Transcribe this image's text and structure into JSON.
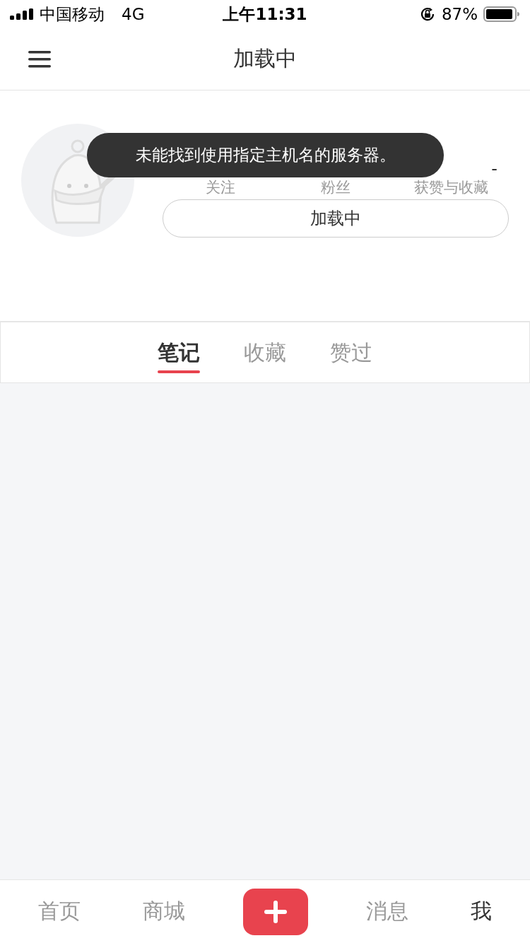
{
  "status_bar": {
    "carrier": "中国移动",
    "network": "4G",
    "time": "上午11:31",
    "battery": "87%"
  },
  "nav": {
    "title": "加载中"
  },
  "profile": {
    "stats": [
      {
        "label": "关注"
      },
      {
        "label": "粉丝"
      },
      {
        "label": "获赞与收藏",
        "value": "-"
      }
    ],
    "button": "加载中"
  },
  "toast": "未能找到使用指定主机名的服务器。",
  "tabs": [
    {
      "label": "笔记",
      "selected": true
    },
    {
      "label": "收藏",
      "selected": false
    },
    {
      "label": "赞过",
      "selected": false
    }
  ],
  "bottom_tabs": [
    {
      "kind": "tab",
      "label": "首页",
      "selected": false
    },
    {
      "kind": "tab",
      "label": "商城",
      "selected": false
    },
    {
      "kind": "add"
    },
    {
      "kind": "tab",
      "label": "消息",
      "selected": false
    },
    {
      "kind": "tab",
      "label": "我",
      "selected": true
    }
  ]
}
